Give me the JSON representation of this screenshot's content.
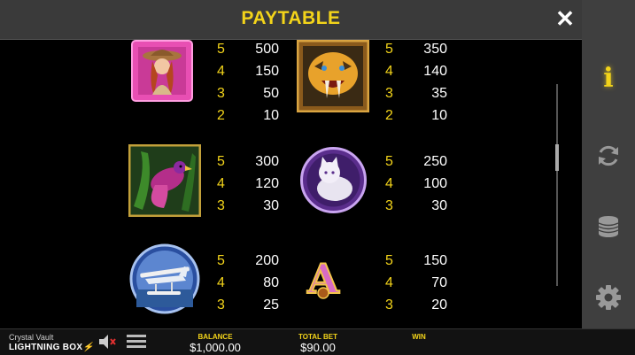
{
  "header": {
    "title": "PAYTABLE",
    "close_label": "✕"
  },
  "sidebar": {
    "info_label": "i"
  },
  "paytable": [
    {
      "symbol": "explorer-woman",
      "pays": [
        {
          "count": "5",
          "value": "500"
        },
        {
          "count": "4",
          "value": "150"
        },
        {
          "count": "3",
          "value": "50"
        },
        {
          "count": "2",
          "value": "10"
        }
      ]
    },
    {
      "symbol": "sabertooth-tiger",
      "pays": [
        {
          "count": "5",
          "value": "350"
        },
        {
          "count": "4",
          "value": "140"
        },
        {
          "count": "3",
          "value": "35"
        },
        {
          "count": "2",
          "value": "10"
        }
      ]
    },
    {
      "symbol": "parrot-bird",
      "pays": [
        {
          "count": "5",
          "value": "300"
        },
        {
          "count": "4",
          "value": "120"
        },
        {
          "count": "3",
          "value": "30"
        }
      ]
    },
    {
      "symbol": "white-cat",
      "pays": [
        {
          "count": "5",
          "value": "250"
        },
        {
          "count": "4",
          "value": "100"
        },
        {
          "count": "3",
          "value": "30"
        }
      ]
    },
    {
      "symbol": "seaplane",
      "pays": [
        {
          "count": "5",
          "value": "200"
        },
        {
          "count": "4",
          "value": "80"
        },
        {
          "count": "3",
          "value": "25"
        }
      ]
    },
    {
      "symbol": "letter-a",
      "letter": "A",
      "pays": [
        {
          "count": "5",
          "value": "150"
        },
        {
          "count": "4",
          "value": "70"
        },
        {
          "count": "3",
          "value": "20"
        }
      ]
    }
  ],
  "footer": {
    "game_name": "Crystal Vault",
    "brand": "LIGHTNING BOX",
    "balance_label": "BALANCE",
    "balance_value": "$1,000.00",
    "total_bet_label": "TOTAL BET",
    "total_bet_value": "$90.00",
    "win_label": "WIN",
    "win_value": ""
  },
  "colors": {
    "accent": "#f3d41a",
    "header_bg": "#3a3a3a",
    "sidebar_bg": "#3f3f3f",
    "background": "#000000"
  }
}
